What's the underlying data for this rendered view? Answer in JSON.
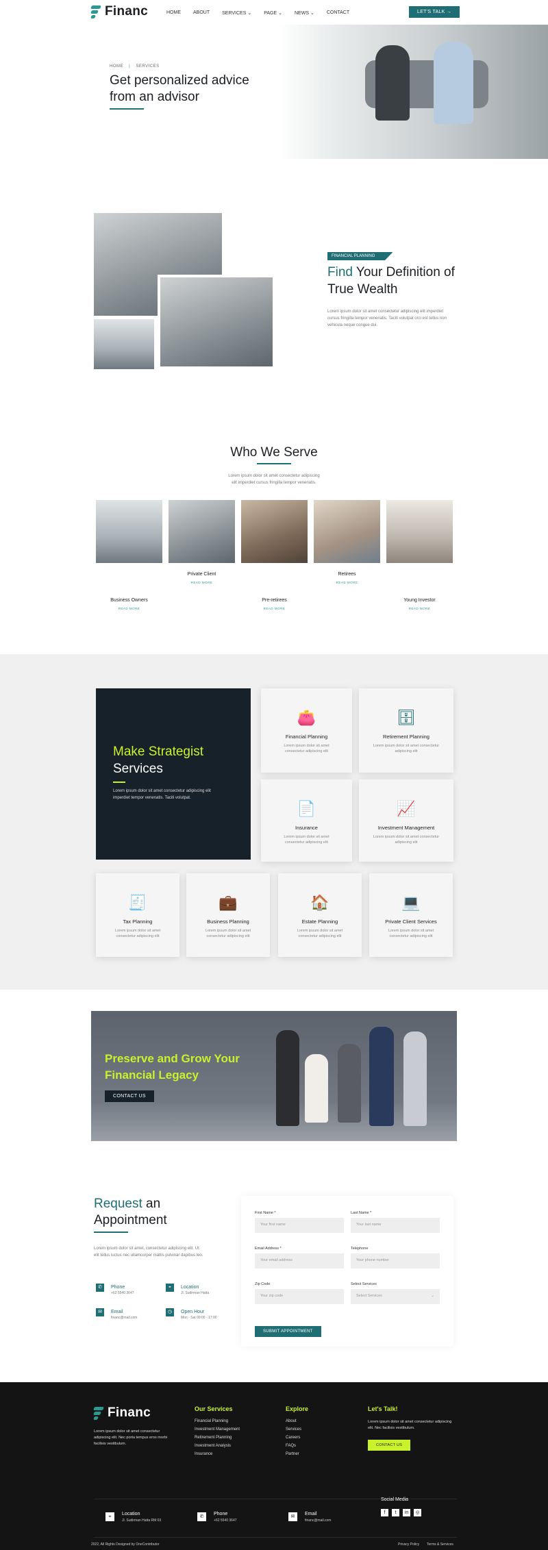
{
  "brand": {
    "name": "Financ"
  },
  "nav": {
    "items": [
      "HOME",
      "ABOUT",
      "SERVICES",
      "PAGE",
      "NEWS",
      "CONTACT"
    ],
    "cta": "LET'S TALK"
  },
  "hero": {
    "breadcrumb_home": "HOME",
    "breadcrumb_current": "SERVICES",
    "title_line1": "Get personalized advice",
    "title_line2": "from an advisor"
  },
  "wealth": {
    "tag": "FINANCIAL PLANNING",
    "title_accent": "Find",
    "title_rest1": " Your Definition of",
    "title_rest2": "True Wealth",
    "body": "Lorem ipsum dolor sit amet consectetur adipiscing elit imperdiet cursus fringilla tempor venenatis. Taciti volutpat orci est tellus non vehicula neque congue dui."
  },
  "serve": {
    "title": "Who We Serve",
    "subtitle1": "Lorem ipsum dolor sit amet consectetur adipiscing",
    "subtitle2": "elit imperdiet cursus fringilla tempor venenatis.",
    "cards": [
      {
        "label": "Business Owners",
        "more": "READ MORE"
      },
      {
        "label": "Private Client",
        "more": "READ MORE"
      },
      {
        "label": "Pre-retirees",
        "more": "READ MORE"
      },
      {
        "label": "Retirees",
        "more": "READ MORE"
      },
      {
        "label": "Young Investor",
        "more": "READ MORE"
      }
    ]
  },
  "strategist": {
    "title_accent": "Make Strategist",
    "title_rest": "Services",
    "body": "Lorem ipsum dolor sit amet consectetur adipiscing elit imperdiet tempor venenatis. Taciti volutpat."
  },
  "services": [
    {
      "title": "Financial Planning",
      "desc": "Lorem ipsum dolor sit amet consectetur adipiscing elit"
    },
    {
      "title": "Retirement Planning",
      "desc": "Lorem ipsum dolor sit amet consectetur adipiscing elit"
    },
    {
      "title": "Insurance",
      "desc": "Lorem ipsum dolor sit amet consectetur adipiscing elit"
    },
    {
      "title": "Investment Management",
      "desc": "Lorem ipsum dolor sit amet consectetur adipiscing elit"
    },
    {
      "title": "Tax Planning",
      "desc": "Lorem ipsum dolor sit amet consectetur adipiscing elit"
    },
    {
      "title": "Business Planning",
      "desc": "Lorem ipsum dolor sit amet consectetur adipiscing elit"
    },
    {
      "title": "Estate Planning",
      "desc": "Lorem ipsum dolor sit amet consectetur adipiscing elit"
    },
    {
      "title": "Private Client Services",
      "desc": "Lorem ipsum dolor sit amet consectetur adipiscing elit"
    }
  ],
  "legacy": {
    "line1": "Preserve and Grow Your",
    "line2": "Financial Legacy",
    "cta": "CONTACT US"
  },
  "appointment": {
    "title_accent": "Request",
    "title_rest1": " an",
    "title_rest2": "Appointment",
    "body": "Lorem ipsum dolor sit amet, consectetur adipiscing elit. Ut elit tellus luctus nec ullamcorper mattis pulvinar dapibus leo.",
    "contacts": [
      {
        "label": "Phone",
        "value": "+62 5540 3647"
      },
      {
        "label": "Location",
        "value": "Jl. Sudirman Hatta"
      },
      {
        "label": "Email",
        "value": "financ@mail.com"
      },
      {
        "label": "Open Hour",
        "value": "Mon - Sat 09:00 - 17:00"
      }
    ],
    "fields": [
      {
        "label": "First Name *",
        "placeholder": "Your first name"
      },
      {
        "label": "Last Name *",
        "placeholder": "Your last name"
      },
      {
        "label": "Email Address *",
        "placeholder": "Your email address"
      },
      {
        "label": "Telephone",
        "placeholder": "Your phone number"
      },
      {
        "label": "Zip Code",
        "placeholder": "Your zip code"
      },
      {
        "label": "Select Services",
        "placeholder": "Select Services"
      }
    ],
    "submit": "SUBMIT APPOINTMENT"
  },
  "footer": {
    "about": "Lorem ipsum dolor sit amet consectetur adipiscing elit. Nec porta tempus eros morbi facilisis vestibulum.",
    "services_title": "Our Services",
    "services": [
      "Financial Planning",
      "Investment Management",
      "Retirement Planning",
      "Investment Analysis",
      "Insurance"
    ],
    "explore_title": "Explore",
    "explore": [
      "About",
      "Services",
      "Careers",
      "FAQs",
      "Partner"
    ],
    "talk_title": "Let's Talk!",
    "talk_body": "Lorem ipsum dolor sit amet consectetur adipiscing elit. Nec facilisis vestibulum.",
    "talk_cta": "CONTACT US",
    "location_label": "Location",
    "location_value": "Jl. Sudirman Hatta RM 03",
    "phone_label": "Phone",
    "phone_value": "+62 5540 3647",
    "email_label": "Email",
    "email_value": "financ@mail.com",
    "social_title": "Social Media",
    "copyright": "2022, All Rights Designed by OneContributor",
    "privacy": "Privacy Policy",
    "terms": "Terms & Services"
  }
}
